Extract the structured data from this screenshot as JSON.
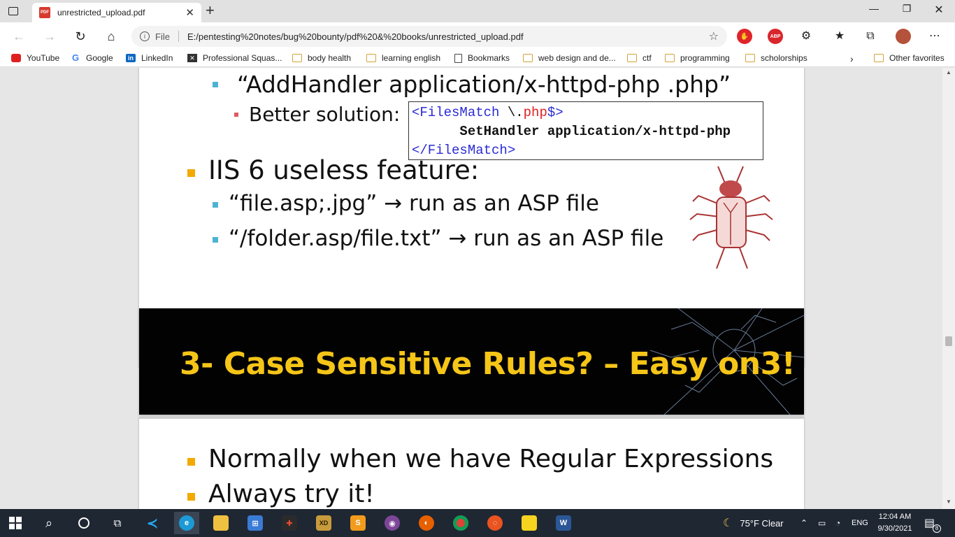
{
  "browser": {
    "tab_title": "unrestricted_upload.pdf",
    "tab_icon_label": "PDF",
    "address_scheme": "File",
    "address_url": "E:/pentesting%20notes/bug%20bounty/pdf%20&%20books/unrestricted_upload.pdf",
    "extension_abp_label": "ABP"
  },
  "favorites": [
    {
      "label": "YouTube",
      "icon": "youtube-icon"
    },
    {
      "label": "Google",
      "icon": "google-icon"
    },
    {
      "label": "LinkedIn",
      "icon": "linkedin-icon"
    },
    {
      "label": "Professional Squas...",
      "icon": "squash-icon"
    },
    {
      "label": "body health",
      "icon": "folder-icon"
    },
    {
      "label": "learning english",
      "icon": "folder-icon"
    },
    {
      "label": "Bookmarks",
      "icon": "page-icon"
    },
    {
      "label": "web design and de...",
      "icon": "folder-icon"
    },
    {
      "label": "ctf",
      "icon": "folder-icon"
    },
    {
      "label": "programming",
      "icon": "folder-icon"
    },
    {
      "label": "scholorships",
      "icon": "folder-icon"
    }
  ],
  "favorites_other": "Other favorites",
  "slide1": {
    "bullet_addhandler": "“AddHandler application/x-httpd-php .php”",
    "better_solution": "Better solution:",
    "code_line1_open": "<FilesMatch ",
    "code_line1_regex_escape": "\\.",
    "code_line1_php": "php",
    "code_line1_end": "$>",
    "code_line2": "SetHandler application/x-httpd-php",
    "code_line3": "</FilesMatch>",
    "iis_heading": "IIS 6 useless feature:",
    "iis_item1": "“file.asp;.jpg” → run as an ASP file",
    "iis_item2": "“/folder.asp/file.txt” → run as an ASP file"
  },
  "slide2": {
    "title": "3- Case Sensitive Rules? – Easy on3!"
  },
  "slide3": {
    "item1": "Normally when we have Regular Expressions",
    "item2": "Always try it!"
  },
  "taskbar": {
    "weather": "75°F  Clear",
    "language": "ENG",
    "time": "12:04 AM",
    "date": "9/30/2021",
    "notifications": "8"
  },
  "colors": {
    "slide_bullet_orange": "#f2a900",
    "slide_bullet_blue": "#4eb3d3",
    "slide_bullet_red": "#e05a63",
    "title_yellow": "#f5c518",
    "code_blue": "#2b2bd6",
    "code_red": "#e02020"
  }
}
